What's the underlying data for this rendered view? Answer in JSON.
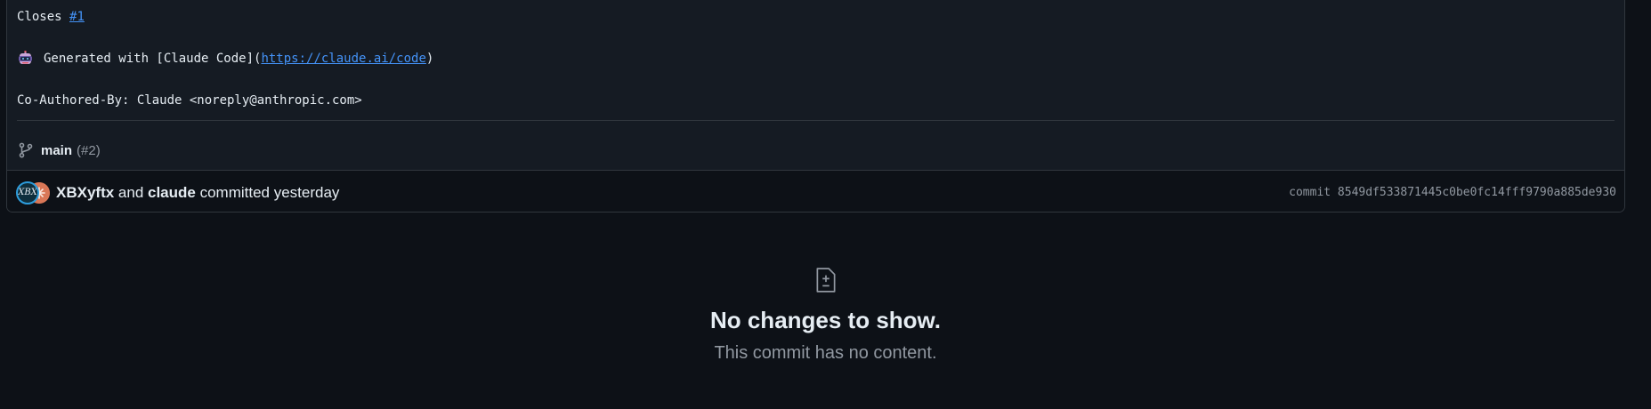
{
  "commit": {
    "message": {
      "line1_prefix": "Closes ",
      "line1_link": "#1",
      "line2_prefix": "Generated with [Claude Code](",
      "line2_link": "https://claude.ai/code",
      "line2_suffix": ")",
      "line3": "Co-Authored-By: Claude <noreply@anthropic.com>"
    },
    "branch": {
      "name": "main",
      "pr": "(#2)"
    },
    "footer": {
      "author1": "XBXyftx",
      "connector": " and ",
      "author2": "claude",
      "action": " committed yesterday",
      "avatar1_text": "XBX",
      "sha_label": "commit 8549df533871445c0be0fc14fff9790a885de930"
    }
  },
  "empty_state": {
    "title": "No changes to show.",
    "subtitle": "This commit has no content."
  },
  "icons": {
    "robot": "robot-emoji-icon",
    "branch": "git-branch-icon",
    "diff": "file-diff-icon"
  },
  "colors": {
    "background": "#0d1117",
    "panel": "#151b23",
    "border": "#30363d",
    "link": "#4493f8",
    "text": "#e6edf3",
    "muted": "#9198a1"
  }
}
